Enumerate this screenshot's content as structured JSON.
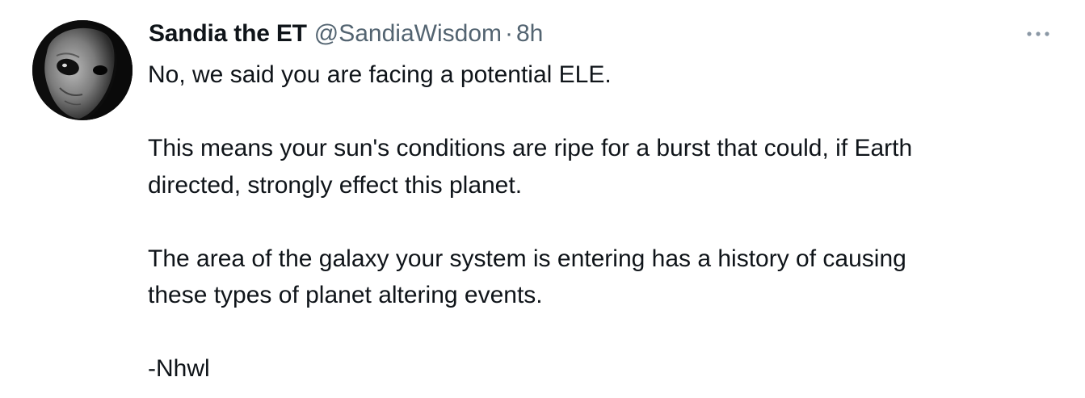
{
  "tweet": {
    "author": {
      "display_name": "Sandia the ET",
      "handle": "@SandiaWisdom",
      "avatar_icon": "alien-face-avatar"
    },
    "separator": "·",
    "time": "8h",
    "more_icon": "more-dots-icon",
    "text": "No, we said you are facing a potential ELE.\n\nThis means your sun's conditions are ripe for a burst that could, if Earth\ndirected, strongly effect this planet.\n\nThe area of the galaxy your system is entering has a history of causing\nthese types of planet altering events.\n\n-Nhwl"
  }
}
